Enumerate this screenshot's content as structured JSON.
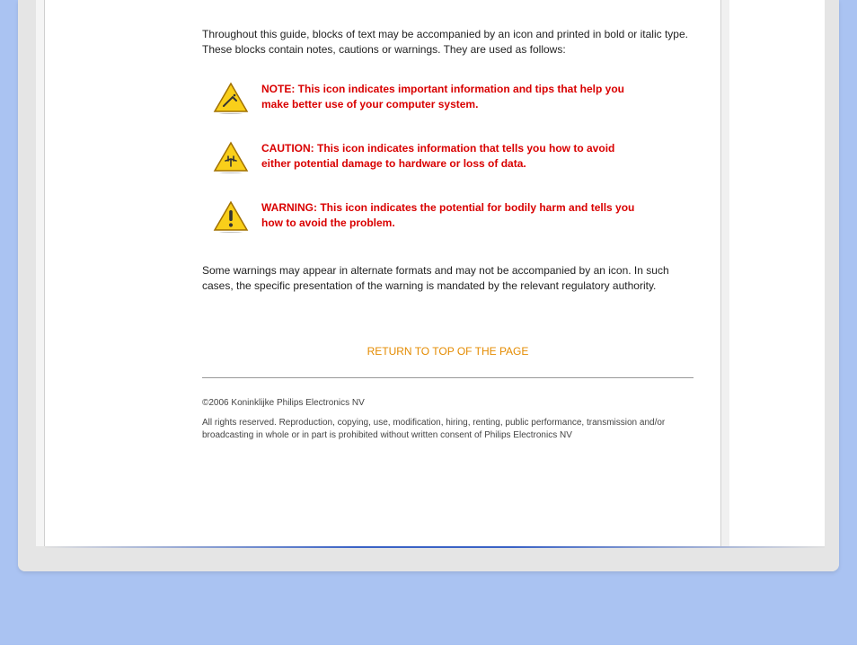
{
  "intro": "Throughout this guide, blocks of text may be accompanied by an icon and printed in bold or italic type. These blocks contain notes, cautions or warnings. They are used as follows:",
  "notices": {
    "note": {
      "text": "NOTE: This icon indicates important information and tips that help you make better use of your computer system.",
      "icon_name": "note-icon"
    },
    "caution": {
      "text": "CAUTION: This icon indicates information that tells you how to avoid either potential damage to hardware or loss of data.",
      "icon_name": "caution-icon"
    },
    "warning": {
      "text": "WARNING: This icon indicates the potential for bodily harm and tells you how to avoid the problem.",
      "icon_name": "warning-icon"
    }
  },
  "closing": "Some warnings may appear in alternate formats and may not be accompanied by an icon. In such cases, the specific presentation of the warning is mandated by the relevant regulatory authority.",
  "return_link": "RETURN TO TOP OF THE PAGE",
  "copyright": "©2006 Koninklijke Philips Electronics NV",
  "rights": "All rights reserved. Reproduction, copying, use, modification, hiring, renting, public performance, transmission and/or broadcasting in whole or in part is prohibited without written consent of Philips Electronics NV"
}
